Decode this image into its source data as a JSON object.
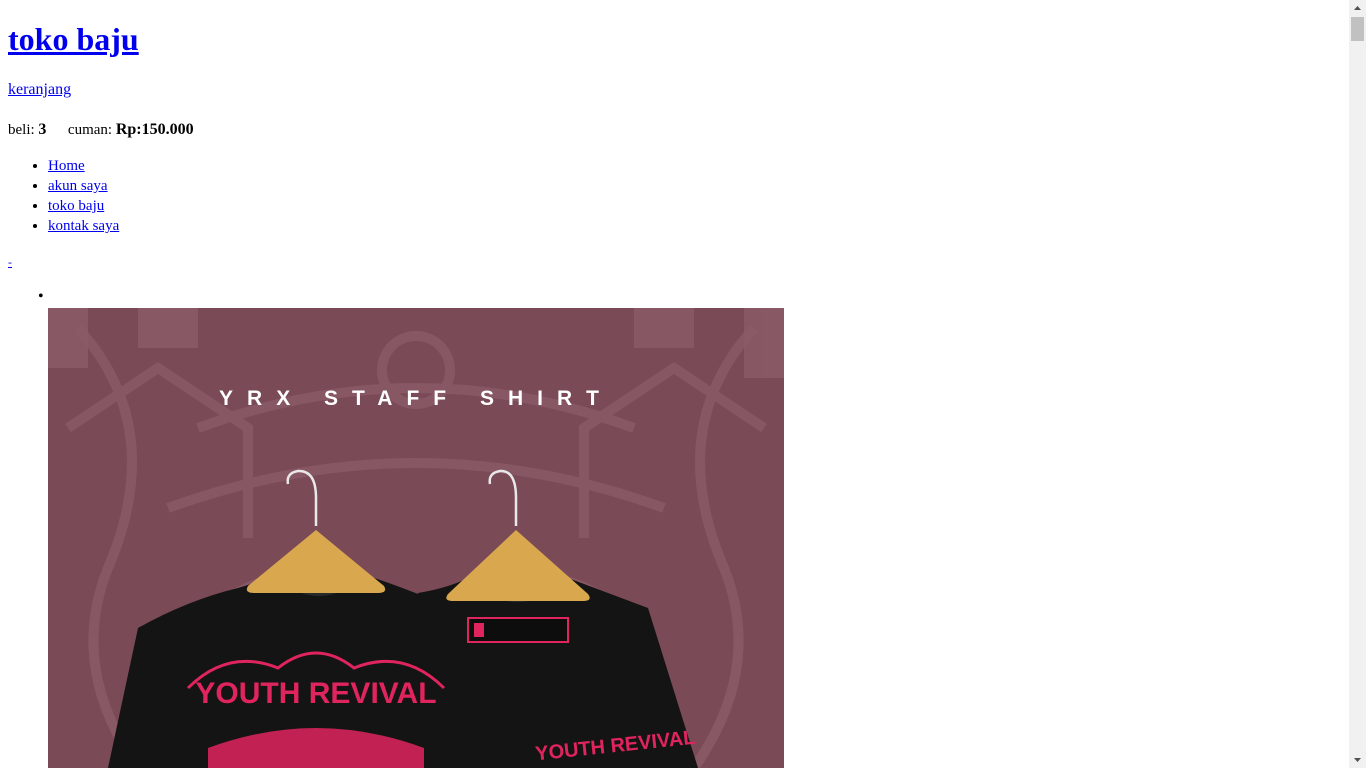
{
  "header": {
    "site_title": "toko baju",
    "cart_link": "keranjang",
    "cart_count_label": "beli:",
    "cart_count": "3",
    "cart_total_label": "cuman:",
    "cart_total": "Rp:150.000"
  },
  "nav": {
    "items": [
      {
        "label": "Home"
      },
      {
        "label": "akun saya"
      },
      {
        "label": "toko baju"
      },
      {
        "label": "kontak saya"
      }
    ]
  },
  "misc": {
    "small_link": "-"
  },
  "product": {
    "banner_text": "YRX STAFF SHIRT",
    "shirt_text_front": "YOUTH REVIVAL",
    "shirt_text_back": "YOUTH REVIVAL",
    "colors": {
      "background": "#7a4a57",
      "shirt": "#141414",
      "print": "#e0245e",
      "hanger": "#d9a84e"
    }
  }
}
